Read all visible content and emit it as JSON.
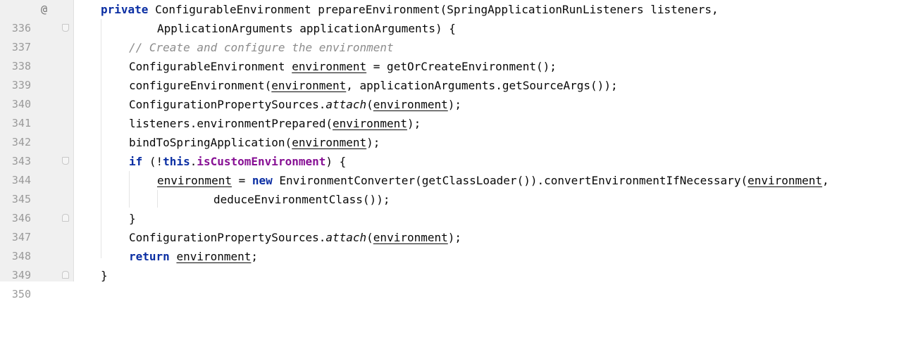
{
  "editor": {
    "gutter": {
      "line_numbers": [
        "336",
        "337",
        "338",
        "339",
        "340",
        "341",
        "342",
        "343",
        "344",
        "345",
        "346",
        "347",
        "348",
        "349",
        "350"
      ],
      "override_marker": "@"
    },
    "code": {
      "l336": {
        "kw_private": "private",
        "sig_a": " ConfigurableEnvironment prepareEnvironment(SpringApplicationRunListeners listeners,"
      },
      "l337": {
        "params": "ApplicationArguments applicationArguments) {"
      },
      "l338": {
        "comment": "// Create and configure the environment"
      },
      "l339": {
        "type": "ConfigurableEnvironment ",
        "var": "environment",
        "rest": " = getOrCreateEnvironment();"
      },
      "l340": {
        "pre": "configureEnvironment(",
        "var": "environment",
        "rest": ", applicationArguments.getSourceArgs());"
      },
      "l341": {
        "pre": "ConfigurationPropertySources.",
        "static_call": "attach",
        "open": "(",
        "var": "environment",
        "rest": ");"
      },
      "l342": {
        "pre": "listeners.environmentPrepared(",
        "var": "environment",
        "rest": ");"
      },
      "l343": {
        "pre": "bindToSpringApplication(",
        "var": "environment",
        "rest": ");"
      },
      "l344": {
        "kw_if": "if",
        "pre": " (!",
        "kw_this": "this",
        "dot": ".",
        "field": "isCustomEnvironment",
        "rest": ") {"
      },
      "l345": {
        "var": "environment",
        "assign": " = ",
        "kw_new": "new",
        "pre": " EnvironmentConverter(getClassLoader()).convertEnvironmentIfNecessary(",
        "var2": "environment",
        "rest": ","
      },
      "l346": {
        "text": "deduceEnvironmentClass());"
      },
      "l347": {
        "text": "}"
      },
      "l348": {
        "pre": "ConfigurationPropertySources.",
        "static_call": "attach",
        "open": "(",
        "var": "environment",
        "rest": ");"
      },
      "l349": {
        "kw_return": "return",
        "space": " ",
        "var": "environment",
        "rest": ";"
      },
      "l350": {
        "text": "}"
      }
    }
  }
}
